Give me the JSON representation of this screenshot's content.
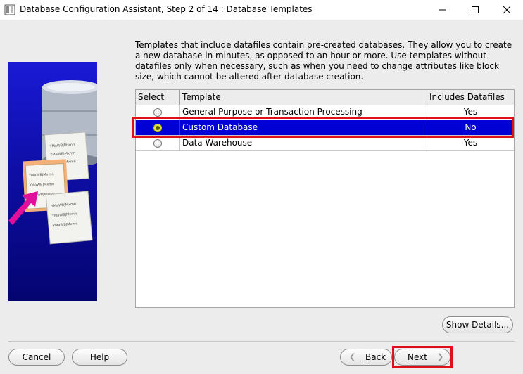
{
  "window": {
    "title": "Database Configuration Assistant, Step 2 of 14 : Database Templates",
    "icons": [
      "app-icon",
      "minimize-icon",
      "maximize-icon",
      "close-icon"
    ]
  },
  "illustration": {
    "doc_text": "YMaWBJMxmn",
    "colors": {
      "background": "#0e0ea6",
      "arrow": "#e0109a",
      "highlight_doc": "#f4b07a"
    }
  },
  "intro": "Templates that include datafiles contain pre-created databases. They allow you to create a new database in minutes, as opposed to an hour or more. Use templates without datafiles only when necessary, such as when you need to change attributes like block size, which cannot be altered after database creation.",
  "table": {
    "columns": {
      "select": "Select",
      "template": "Template",
      "includes": "Includes Datafiles"
    },
    "rows": [
      {
        "template": "General Purpose or Transaction Processing",
        "includes": "Yes",
        "selected": false
      },
      {
        "template": "Custom Database",
        "includes": "No",
        "selected": true
      },
      {
        "template": "Data Warehouse",
        "includes": "Yes",
        "selected": false
      }
    ]
  },
  "buttons": {
    "show_details": "Show Details...",
    "cancel": "Cancel",
    "help": "Help",
    "back_mnemonic": "B",
    "back_rest": "ack",
    "next_mnemonic": "N",
    "next_rest": "ext"
  },
  "colors": {
    "selection": "#0000d4",
    "annotation_box": "#e0101a"
  }
}
